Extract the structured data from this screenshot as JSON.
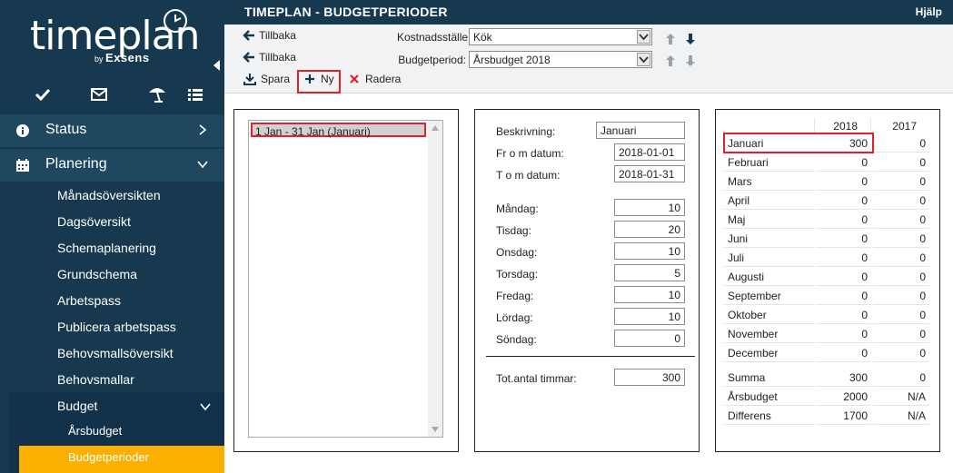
{
  "app": {
    "logo_text": "timeplan",
    "logo_by": "by",
    "logo_brand": "Exsens"
  },
  "sidebar": {
    "nav": [
      {
        "label": "Status"
      },
      {
        "label": "Planering"
      }
    ],
    "sub_items": [
      "Månadsöversikten",
      "Dagsöversikt",
      "Schemaplanering",
      "Grundschema",
      "Arbetspass",
      "Publicera arbetspass",
      "Behovsmallsöversikt",
      "Behovsmallar"
    ],
    "budget": {
      "label": "Budget",
      "children": [
        "Årsbudget",
        "Budgetperioder"
      ]
    }
  },
  "header": {
    "title": "TIMEPLAN - BUDGETPERIODER",
    "help": "Hjälp"
  },
  "toolbar": {
    "back1": "Tillbaka",
    "back2": "Tillbaka",
    "cost_center_label": "Kostnadsställe:",
    "cost_center_value": "Kök",
    "budget_period_label": "Budgetperiod:",
    "budget_period_value": "Årsbudget 2018",
    "save": "Spara",
    "new": "Ny",
    "delete": "Radera"
  },
  "periods": {
    "items": [
      "1 Jan - 31 Jan (Januari)"
    ],
    "selected_index": 0
  },
  "form": {
    "description_label": "Beskrivning:",
    "description_value": "Januari",
    "from_label": "Fr o m datum:",
    "from_value": "2018-01-01",
    "to_label": "T o m datum:",
    "to_value": "2018-01-31",
    "days": [
      {
        "label": "Måndag:",
        "value": "10"
      },
      {
        "label": "Tisdag:",
        "value": "20"
      },
      {
        "label": "Onsdag:",
        "value": "10"
      },
      {
        "label": "Torsdag:",
        "value": "5"
      },
      {
        "label": "Fredag:",
        "value": "10"
      },
      {
        "label": "Lördag:",
        "value": "10"
      },
      {
        "label": "Söndag:",
        "value": "0"
      }
    ],
    "total_label": "Tot.antal timmar:",
    "total_value": "300"
  },
  "months_table": {
    "columns": [
      "2018",
      "2017"
    ],
    "rows": [
      {
        "month": "Januari",
        "v2018": "300",
        "v2017": "0"
      },
      {
        "month": "Februari",
        "v2018": "0",
        "v2017": "0"
      },
      {
        "month": "Mars",
        "v2018": "0",
        "v2017": "0"
      },
      {
        "month": "April",
        "v2018": "0",
        "v2017": "0"
      },
      {
        "month": "Maj",
        "v2018": "0",
        "v2017": "0"
      },
      {
        "month": "Juni",
        "v2018": "0",
        "v2017": "0"
      },
      {
        "month": "Juli",
        "v2018": "0",
        "v2017": "0"
      },
      {
        "month": "Augusti",
        "v2018": "0",
        "v2017": "0"
      },
      {
        "month": "September",
        "v2018": "0",
        "v2017": "0"
      },
      {
        "month": "Oktober",
        "v2018": "0",
        "v2017": "0"
      },
      {
        "month": "November",
        "v2018": "0",
        "v2017": "0"
      },
      {
        "month": "December",
        "v2018": "0",
        "v2017": "0"
      }
    ],
    "summary": [
      {
        "label": "Summa",
        "v2018": "300",
        "v2017": "0"
      },
      {
        "label": "Årsbudget",
        "v2018": "2000",
        "v2017": "N/A"
      },
      {
        "label": "Differens",
        "v2018": "1700",
        "v2017": "N/A"
      }
    ]
  },
  "colors": {
    "sidebar_bg": "#17394f",
    "accent_active": "#f9b000",
    "highlight_red": "#e0202c"
  }
}
